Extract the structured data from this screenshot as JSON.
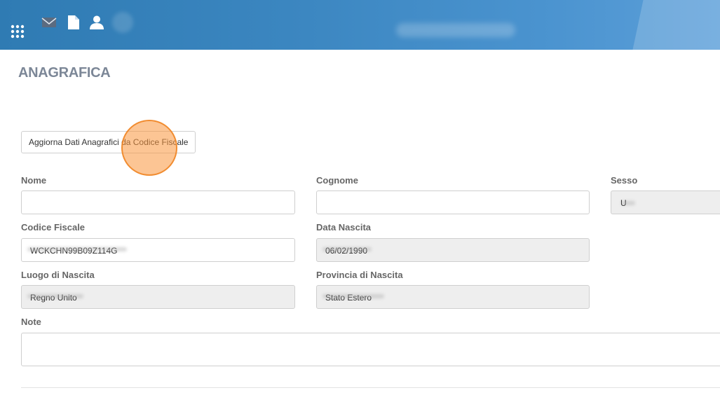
{
  "header": {
    "icons": [
      "apps-grid-icon",
      "mail-icon",
      "document-icon",
      "user-icon"
    ],
    "accent": "#3b86c0"
  },
  "page": {
    "title": "ANAGRAFICA"
  },
  "actions": {
    "update_button": "Aggiorna Dati Anagrafici da Codice Fiscale"
  },
  "form": {
    "nome": {
      "label": "Nome",
      "value": ""
    },
    "cognome": {
      "label": "Cognome",
      "value": ""
    },
    "sesso": {
      "label": "Sesso",
      "value": "U"
    },
    "codice_fiscale": {
      "label": "Codice Fiscale",
      "value": "WCKCHN99B09Z114G"
    },
    "data_nascita": {
      "label": "Data Nascita",
      "value": "06/02/1990"
    },
    "luogo_nascita": {
      "label": "Luogo di Nascita",
      "value": "Regno Unito"
    },
    "provincia_nascita": {
      "label": "Provincia di Nascita",
      "value": "Stato Estero"
    },
    "note": {
      "label": "Note",
      "value": ""
    }
  },
  "colors": {
    "title": "#7c8797",
    "label": "#666666",
    "readonly_bg": "#eeeeee",
    "click_marker": "#f7a050"
  }
}
